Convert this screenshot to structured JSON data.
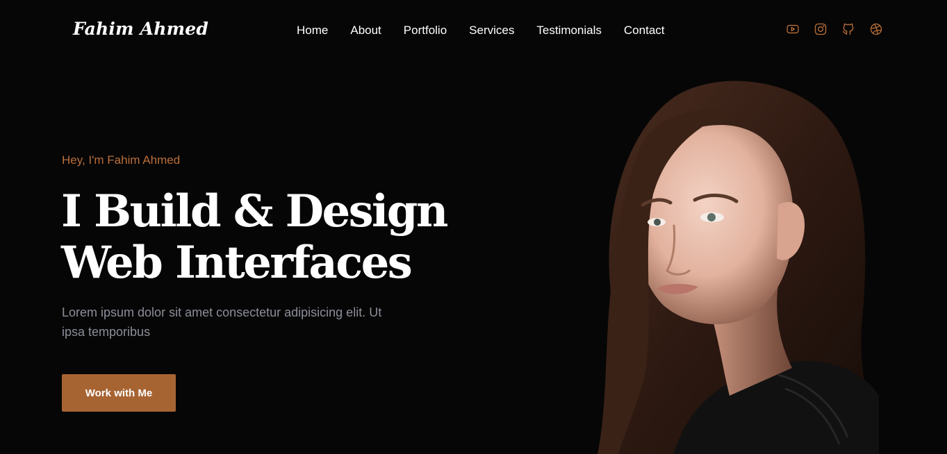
{
  "header": {
    "logo": "Fahim Ahmed",
    "nav": [
      "Home",
      "About",
      "Portfolio",
      "Services",
      "Testimonials",
      "Contact"
    ],
    "socials": [
      "youtube-icon",
      "instagram-icon",
      "github-icon",
      "dribbble-icon"
    ]
  },
  "hero": {
    "greeting": "Hey, I'm Fahim Ahmed",
    "headline_line1": "I Build & Design",
    "headline_line2": "Web Interfaces",
    "description": "Lorem ipsum dolor sit amet consectetur adipisicing elit. Ut ipsa temporibus",
    "cta_label": "Work with Me"
  },
  "colors": {
    "background": "#070606",
    "accent": "#b96f3a",
    "button": "#a76433",
    "text": "#ffffff",
    "muted": "#8b8f99"
  }
}
